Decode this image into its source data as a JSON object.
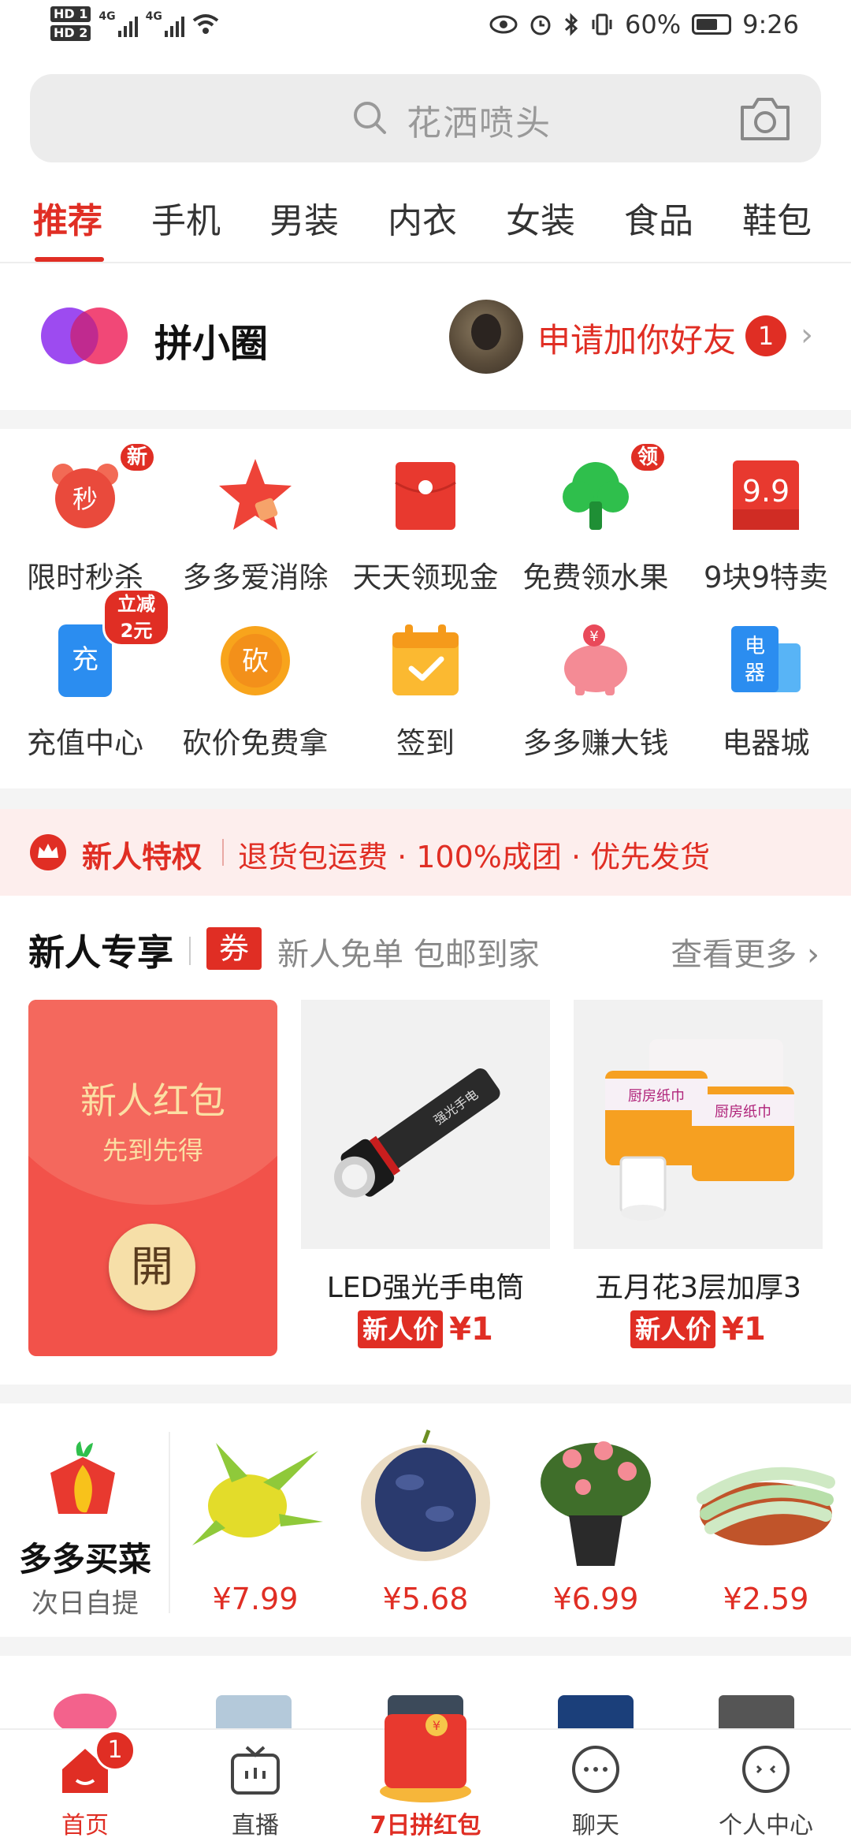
{
  "status_bar": {
    "battery": "60%",
    "time": "9:26",
    "hd1": "HD 1",
    "hd2": "HD 2",
    "net1": "4G",
    "net2": "4G"
  },
  "search": {
    "placeholder": "花洒喷头"
  },
  "tabs": [
    "推荐",
    "手机",
    "男装",
    "内衣",
    "女装",
    "食品",
    "鞋包"
  ],
  "circle": {
    "title": "拼小圈",
    "friend_request": "申请加你好友",
    "badge": "1"
  },
  "grid": [
    {
      "label": "限时秒杀",
      "icon": "seckill-clock-icon",
      "icon_text": "秒",
      "badge": "新"
    },
    {
      "label": "多多爱消除",
      "icon": "star-game-icon"
    },
    {
      "label": "天天领现金",
      "icon": "red-envelope-icon"
    },
    {
      "label": "免费领水果",
      "icon": "tree-icon",
      "badge": "领"
    },
    {
      "label": "9块9特卖",
      "icon": "price-tag-icon",
      "icon_text": "9.9"
    },
    {
      "label": "充值中心",
      "icon": "phone-recharge-icon",
      "icon_text": "充",
      "badge": "立减2元"
    },
    {
      "label": "砍价免费拿",
      "icon": "bargain-icon",
      "icon_text": "砍"
    },
    {
      "label": "签到",
      "icon": "calendar-check-icon"
    },
    {
      "label": "多多赚大钱",
      "icon": "piggy-bank-icon",
      "icon_text": "¥"
    },
    {
      "label": "电器城",
      "icon": "appliance-icon",
      "icon_text": "电器"
    }
  ],
  "privilege": {
    "title": "新人特权",
    "text": "退货包运费 · 100%成团 · 优先发货"
  },
  "exclusive": {
    "title": "新人专享",
    "coupon": "券",
    "subtitle": "新人免单 包邮到家",
    "more": "查看更多"
  },
  "red_packet": {
    "title": "新人红包",
    "subtitle": "先到先得",
    "open": "開"
  },
  "products": [
    {
      "name": "LED强光手电筒",
      "tag": "新人价",
      "price": "¥1",
      "image_text": "强光手电"
    },
    {
      "name": "五月花3层加厚3",
      "tag": "新人价",
      "price": "¥1",
      "image_text": "厨房纸巾"
    }
  ],
  "grocery": {
    "title": "多多买菜",
    "subtitle": "次日自提",
    "items": [
      {
        "price": "¥7.99",
        "icon": "dragon-fruit-icon"
      },
      {
        "price": "¥5.68",
        "icon": "grapes-icon"
      },
      {
        "price": "¥6.99",
        "icon": "potted-rose-icon"
      },
      {
        "price": "¥2.59",
        "icon": "green-beans-icon"
      }
    ]
  },
  "bottom_nav": [
    {
      "label": "首页",
      "icon": "home-icon",
      "badge": "1"
    },
    {
      "label": "直播",
      "icon": "tv-icon"
    },
    {
      "label": "7日拼红包",
      "icon": "red-packet-icon"
    },
    {
      "label": "聊天",
      "icon": "chat-icon"
    },
    {
      "label": "个人中心",
      "icon": "profile-icon"
    }
  ],
  "colors": {
    "brand_red": "#e02e24",
    "background_gray": "#f4f4f4"
  }
}
